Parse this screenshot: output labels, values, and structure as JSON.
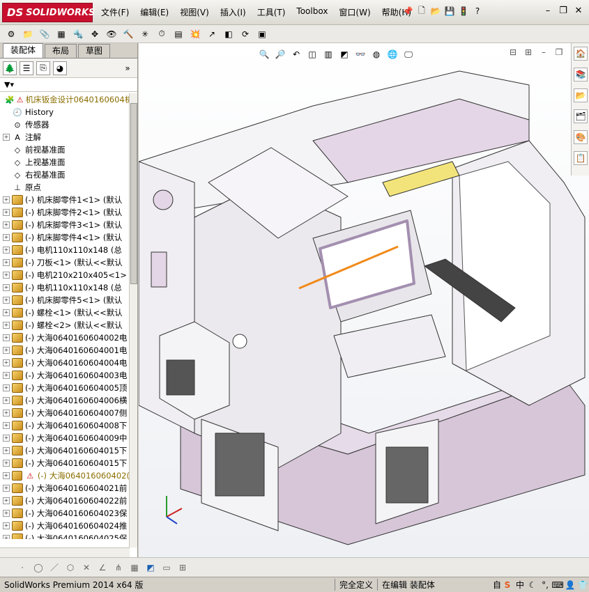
{
  "app": {
    "logo_text": "SOLIDWORKS",
    "logo_mark": "DS"
  },
  "menu": [
    "文件(F)",
    "编辑(E)",
    "视图(V)",
    "插入(I)",
    "工具(T)",
    "Toolbox",
    "窗口(W)",
    "帮助(H)"
  ],
  "tabs": [
    "装配体",
    "布局",
    "草图"
  ],
  "tree": {
    "root": "机床钣金设计0640160604机",
    "items": [
      {
        "label": "History",
        "icon": "history-icon",
        "expand": false
      },
      {
        "label": "传感器",
        "icon": "sensor-icon",
        "expand": false
      },
      {
        "label": "注解",
        "icon": "annotation-icon",
        "expand": true
      },
      {
        "label": "前视基准面",
        "icon": "plane-icon",
        "expand": false
      },
      {
        "label": "上视基准面",
        "icon": "plane-icon",
        "expand": false
      },
      {
        "label": "右视基准面",
        "icon": "plane-icon",
        "expand": false
      },
      {
        "label": "原点",
        "icon": "origin-icon",
        "expand": false
      },
      {
        "label": "(-) 机床脚零件1<1> (默认",
        "icon": "part",
        "expand": true
      },
      {
        "label": "(-) 机床脚零件2<1> (默认",
        "icon": "part",
        "expand": true
      },
      {
        "label": "(-) 机床脚零件3<1> (默认",
        "icon": "part",
        "expand": true
      },
      {
        "label": "(-) 机床脚零件4<1> (默认",
        "icon": "part",
        "expand": true
      },
      {
        "label": "(-) 电机110x110x148 (总",
        "icon": "part",
        "expand": true
      },
      {
        "label": "(-) 刀板<1> (默认<<默认",
        "icon": "part",
        "expand": true
      },
      {
        "label": "(-) 电机210x210x405<1>",
        "icon": "part",
        "expand": true
      },
      {
        "label": "(-) 电机110x110x148 (总",
        "icon": "part",
        "expand": true
      },
      {
        "label": "(-) 机床脚零件5<1> (默认",
        "icon": "part",
        "expand": true
      },
      {
        "label": "(-) 螺栓<1> (默认<<默认",
        "icon": "part",
        "expand": true
      },
      {
        "label": "(-) 螺栓<2> (默认<<默认",
        "icon": "part",
        "expand": true
      },
      {
        "label": "(-) 大海0640160604002电",
        "icon": "part",
        "expand": true
      },
      {
        "label": "(-) 大海0640160604001电",
        "icon": "part",
        "expand": true
      },
      {
        "label": "(-) 大海0640160604004电",
        "icon": "part",
        "expand": true
      },
      {
        "label": "(-) 大海0640160604003电",
        "icon": "part",
        "expand": true
      },
      {
        "label": "(-) 大海0640160604005顶",
        "icon": "part",
        "expand": true
      },
      {
        "label": "(-) 大海0640160604006横",
        "icon": "part",
        "expand": true
      },
      {
        "label": "(-) 大海0640160604007侧",
        "icon": "part",
        "expand": true
      },
      {
        "label": "(-) 大海0640160604008下",
        "icon": "part",
        "expand": true
      },
      {
        "label": "(-) 大海0640160604009中",
        "icon": "part",
        "expand": true
      },
      {
        "label": "(-) 大海0640160604015下",
        "icon": "part",
        "expand": true
      },
      {
        "label": "(-) 大海0640160604015下",
        "icon": "part",
        "expand": true
      },
      {
        "label": "(-) 大海064016060402(",
        "icon": "warn",
        "expand": true
      },
      {
        "label": "(-) 大海0640160604021前",
        "icon": "part",
        "expand": true
      },
      {
        "label": "(-) 大海0640160604022前",
        "icon": "part",
        "expand": true
      },
      {
        "label": "(-) 大海0640160604023保",
        "icon": "part",
        "expand": true
      },
      {
        "label": "(-) 大海0640160604024推",
        "icon": "part",
        "expand": true
      },
      {
        "label": "(-) 大海0640160604025保",
        "icon": "part",
        "expand": true
      }
    ]
  },
  "status": {
    "version": "SolidWorks Premium 2014 x64 版",
    "state": "完全定义",
    "mode": "在编辑 装配体",
    "ime_prefix": "自"
  },
  "colors": {
    "brand": "#c8102e",
    "model_body": "#d9c9da",
    "model_white": "#f4f4f6",
    "accent_orange": "#f08a1a",
    "accent_yellow": "#f2e47a"
  }
}
